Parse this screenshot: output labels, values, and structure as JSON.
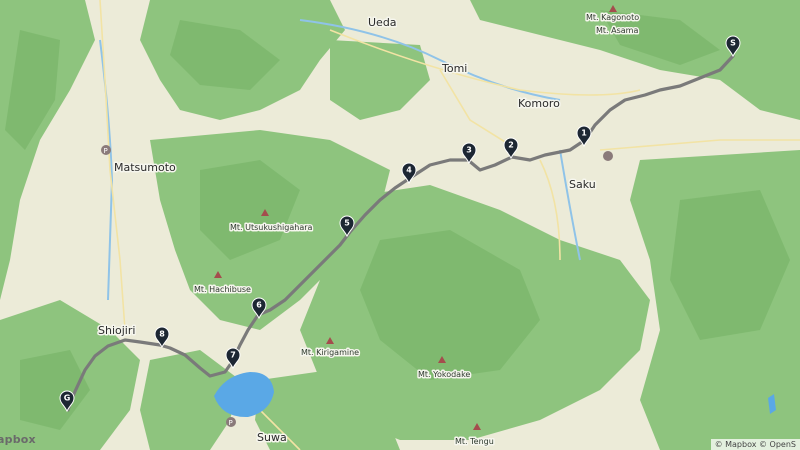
{
  "map": {
    "places": {
      "ueda": "Ueda",
      "tomi": "Tomi",
      "komoro": "Komoro",
      "saku": "Saku",
      "matsumoto": "Matsumoto",
      "shiojiri": "Shiojiri",
      "suwa": "Suwa"
    },
    "mountains": {
      "kagonoto": "Mt. Kagonoto",
      "asama": "Mt. Asama",
      "utsukushigahara": "Mt. Utsukushigahara",
      "hachibuse": "Mt. Hachibuse",
      "kirigamine": "Mt. Kirigamine",
      "yokodake": "Mt. Yokodake",
      "tengu": "Mt. Tengu"
    },
    "pins": {
      "start": "S",
      "p1": "1",
      "p2": "2",
      "p3": "3",
      "p4": "4",
      "p5": "5",
      "p6": "6",
      "p7": "7",
      "p8": "8",
      "goal": "G"
    },
    "route_color": "#7a7a7a",
    "pin_color": "#1d2733",
    "forest_color": "#8cc27d",
    "lake_color": "#5aa8e6"
  },
  "attribution": "© Mapbox © OpenS",
  "logo": "apbox"
}
